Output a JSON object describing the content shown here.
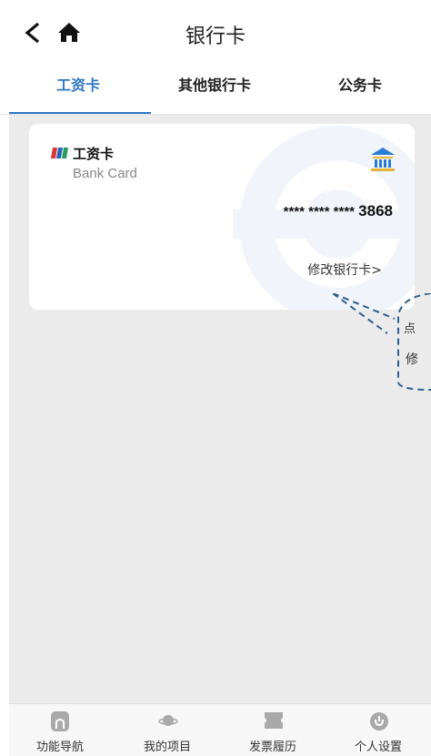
{
  "header": {
    "title": "银行卡",
    "back_icon": "chevron-left-icon",
    "home_icon": "home-icon"
  },
  "tabs": [
    {
      "label": "工资卡",
      "active": true
    },
    {
      "label": "其他银行卡",
      "active": false
    },
    {
      "label": "公务卡",
      "active": false
    }
  ],
  "card": {
    "title": "工资卡",
    "subtitle": "Bank Card",
    "number_masked": "**** **** ****",
    "number_last4": "3868",
    "modify_label": "修改银行卡>",
    "bank_icon": "bank-icon"
  },
  "hint": {
    "line1": "点",
    "line2": "修"
  },
  "bottom_nav": [
    {
      "label": "功能导航",
      "icon": "home-icon"
    },
    {
      "label": "我的项目",
      "icon": "planet-icon"
    },
    {
      "label": "发票履历",
      "icon": "ticket-icon"
    },
    {
      "label": "个人设置",
      "icon": "power-icon"
    }
  ],
  "colors": {
    "accent": "#2f78c4",
    "background": "#ebebeb",
    "bank_icon": "#2a7bd6"
  }
}
